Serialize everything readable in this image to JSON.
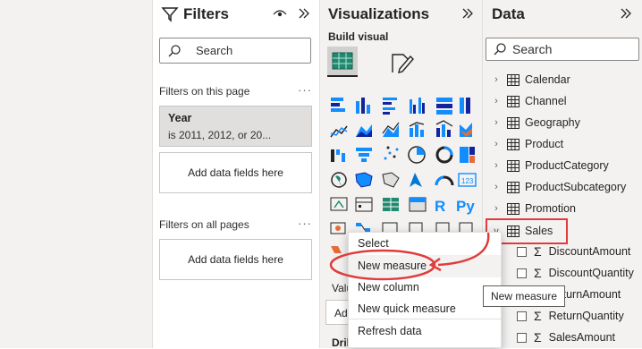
{
  "filters": {
    "title": "Filters",
    "search_placeholder": "Search",
    "on_this_page_label": "Filters on this page",
    "year_card": {
      "title": "Year",
      "value": "is 2011, 2012, or 20..."
    },
    "add_fields_label_1": "Add data fields here",
    "on_all_pages_label": "Filters on all pages",
    "add_fields_label_2": "Add data fields here",
    "more": "···"
  },
  "visualizations": {
    "title": "Visualizations",
    "build_visual_label": "Build visual",
    "values_partial": "Valu",
    "add_partial": "Add",
    "drill_partial": "Dril"
  },
  "data": {
    "title": "Data",
    "search_placeholder": "Search",
    "tables": [
      "Calendar",
      "Channel",
      "Geography",
      "Product",
      "ProductCategory",
      "ProductSubcategory",
      "Promotion"
    ],
    "sales_table": "Sales",
    "sales_fields": [
      "DiscountAmount",
      "DiscountQuantity",
      "ReturnAmount",
      "ReturnQuantity",
      "SalesAmount"
    ]
  },
  "context_menu": {
    "items": [
      "Select",
      "New measure",
      "New column",
      "New quick measure",
      "Refresh data"
    ]
  },
  "tooltip": "New measure",
  "colors": {
    "accent_red": "#e03c3c",
    "teal": "#1f8a70",
    "blue": "#118dff"
  }
}
